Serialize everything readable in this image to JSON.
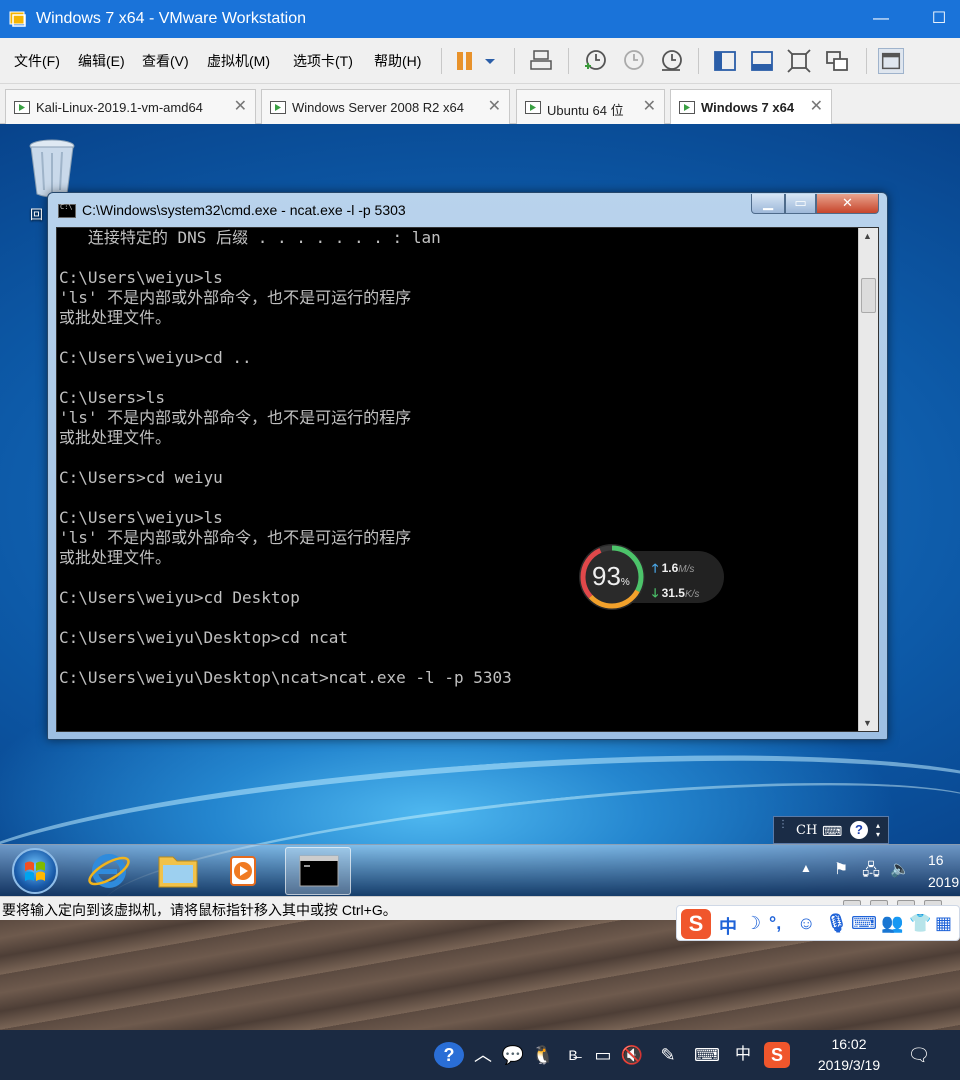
{
  "vm_window": {
    "title": "Windows 7 x64 - VMware Workstation",
    "menus": [
      "文件(F)",
      "编辑(E)",
      "查看(V)",
      "虚拟机(M)",
      "选项卡(T)",
      "帮助(H)"
    ],
    "tabs": [
      {
        "label": "Kali-Linux-2019.1-vm-amd64",
        "active": false
      },
      {
        "label": "Windows Server 2008 R2 x64",
        "active": false
      },
      {
        "label": "Ubuntu 64 位",
        "active": false
      },
      {
        "label": "Windows 7 x64",
        "active": true
      }
    ],
    "status_message": "要将输入定向到该虚拟机，请将鼠标指针移入其中或按 Ctrl+G。",
    "brand_color": "#1a73d9"
  },
  "guest": {
    "recycle_bin_label": "回",
    "cmd": {
      "title": "C:\\Windows\\system32\\cmd.exe - ncat.exe  -l -p 5303",
      "lines": [
        "   连接特定的 DNS 后缀 . . . . . . . : lan",
        "",
        "C:\\Users\\weiyu>ls",
        "'ls' 不是内部或外部命令，也不是可运行的程序",
        "或批处理文件。",
        "",
        "C:\\Users\\weiyu>cd ..",
        "",
        "C:\\Users>ls",
        "'ls' 不是内部或外部命令，也不是可运行的程序",
        "或批处理文件。",
        "",
        "C:\\Users>cd weiyu",
        "",
        "C:\\Users\\weiyu>ls",
        "'ls' 不是内部或外部命令，也不是可运行的程序",
        "或批处理文件。",
        "",
        "C:\\Users\\weiyu>cd Desktop",
        "",
        "C:\\Users\\weiyu\\Desktop>cd ncat",
        "",
        "C:\\Users\\weiyu\\Desktop\\ncat>ncat.exe -l -p 5303"
      ]
    },
    "net_meter": {
      "percent": "93",
      "percent_unit": "%",
      "upload": "1.6",
      "upload_unit": "M/s",
      "download": "31.5",
      "download_unit": "K/s"
    },
    "language_bar": {
      "lang": "CH",
      "help": "?"
    },
    "taskbar": {
      "apps": [
        "internet-explorer",
        "windows-explorer",
        "media-player",
        "command-prompt"
      ],
      "clock_time": "16",
      "clock_date": "2019"
    }
  },
  "host": {
    "ime_label": "中",
    "tray_lang": "中",
    "clock_time": "16:02",
    "clock_date": "2019/3/19"
  }
}
